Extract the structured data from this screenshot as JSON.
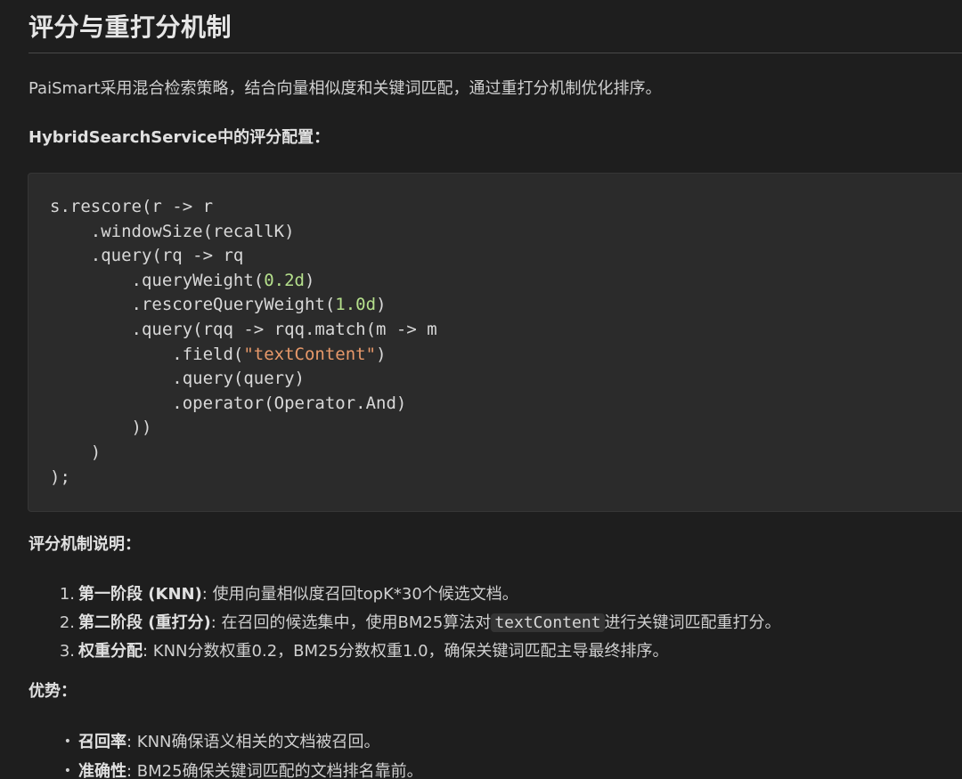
{
  "heading": "评分与重打分机制",
  "intro": "PaiSmart采用混合检索策略，结合向量相似度和关键词匹配，通过重打分机制优化排序。",
  "config_label": "HybridSearchService中的评分配置：",
  "code": {
    "lines": [
      [
        {
          "t": "s.rescore(r -> r",
          "k": "plain"
        }
      ],
      [
        {
          "t": "    .windowSize(recallK)",
          "k": "plain"
        }
      ],
      [
        {
          "t": "    .query(rq -> rq",
          "k": "plain"
        }
      ],
      [
        {
          "t": "        .queryWeight(",
          "k": "plain"
        },
        {
          "t": "0.2d",
          "k": "num"
        },
        {
          "t": ")",
          "k": "plain"
        }
      ],
      [
        {
          "t": "        .rescoreQueryWeight(",
          "k": "plain"
        },
        {
          "t": "1.0d",
          "k": "num"
        },
        {
          "t": ")",
          "k": "plain"
        }
      ],
      [
        {
          "t": "        .query(rqq -> rqq.match(m -> m",
          "k": "plain"
        }
      ],
      [
        {
          "t": "            .field(",
          "k": "plain"
        },
        {
          "t": "\"textContent\"",
          "k": "str"
        },
        {
          "t": ")",
          "k": "plain"
        }
      ],
      [
        {
          "t": "            .query(query)",
          "k": "plain"
        }
      ],
      [
        {
          "t": "            .operator(Operator.And)",
          "k": "plain"
        }
      ],
      [
        {
          "t": "        ))",
          "k": "plain"
        }
      ],
      [
        {
          "t": "    )",
          "k": "plain"
        }
      ],
      [
        {
          "t": ");",
          "k": "plain"
        }
      ]
    ]
  },
  "mechanism_label": "评分机制说明：",
  "mechanism_items": [
    {
      "num": "1.",
      "bold": "第一阶段 (KNN)",
      "rest": ": 使用向量相似度召回topK*30个候选文档。"
    },
    {
      "num": "2.",
      "bold": "第二阶段 (重打分)",
      "rest_before": ": 在召回的候选集中，使用BM25算法对",
      "code": "textContent",
      "rest_after": "进行关键词匹配重打分。"
    },
    {
      "num": "3.",
      "bold": "权重分配",
      "rest": ": KNN分数权重0.2，BM25分数权重1.0，确保关键词匹配主导最终排序。"
    }
  ],
  "advantages_label": "优势：",
  "advantages_items": [
    {
      "bullet": "•",
      "bold": "召回率",
      "rest": ": KNN确保语义相关的文档被召回。"
    },
    {
      "bullet": "•",
      "bold": "准确性",
      "rest": ": BM25确保关键词匹配的文档排名靠前。"
    }
  ],
  "colors": {
    "background": "#1e1e1e",
    "code_background": "#2b2b2b",
    "number_literal": "#b5e08c",
    "string_literal": "#e8996a"
  }
}
